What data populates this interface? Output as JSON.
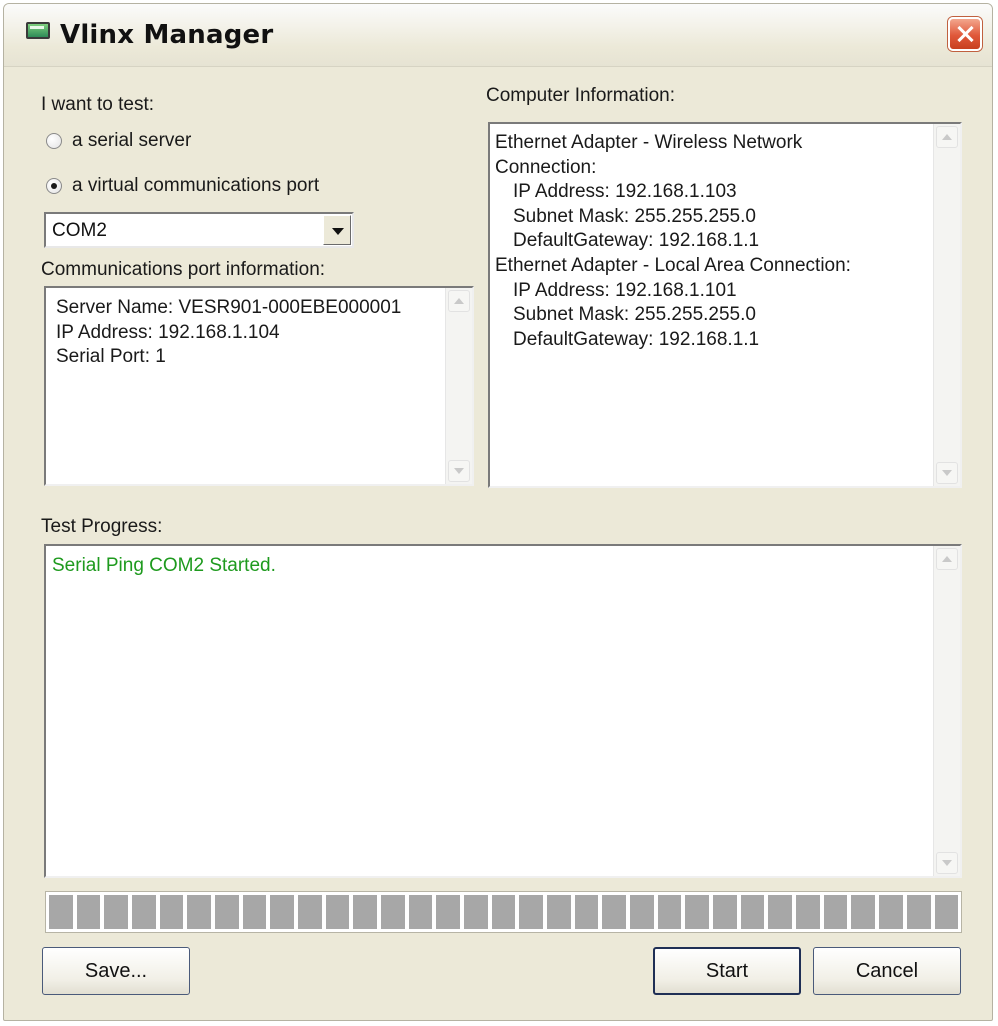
{
  "window": {
    "title": "Vlinx Manager"
  },
  "test_selector": {
    "label": "I want to test:",
    "options": [
      {
        "label": "a serial server",
        "checked": false
      },
      {
        "label": "a virtual communications port",
        "checked": true
      }
    ],
    "port_select": {
      "value": "COM2"
    }
  },
  "port_info": {
    "label": "Communications port information:",
    "lines": [
      "Server Name: VESR901-000EBE000001",
      "IP Address: 192.168.1.104",
      "Serial Port: 1"
    ]
  },
  "computer_info": {
    "label": "Computer Information:",
    "lines": [
      "Ethernet Adapter - Wireless Network",
      "Connection:",
      "   IP Address: 192.168.1.103",
      "   Subnet Mask: 255.255.255.0",
      "   DefaultGateway: 192.168.1.1",
      "Ethernet Adapter - Local Area Connection:",
      "   IP Address: 192.168.1.101",
      "   Subnet Mask: 255.255.255.0",
      "   DefaultGateway: 192.168.1.1"
    ]
  },
  "test_progress": {
    "label": "Test Progress:",
    "log": [
      "Serial Ping COM2 Started."
    ],
    "log_color": "#1e9a1e",
    "progress_fraction": 1.0
  },
  "buttons": {
    "save": "Save...",
    "start": "Start",
    "cancel": "Cancel"
  }
}
